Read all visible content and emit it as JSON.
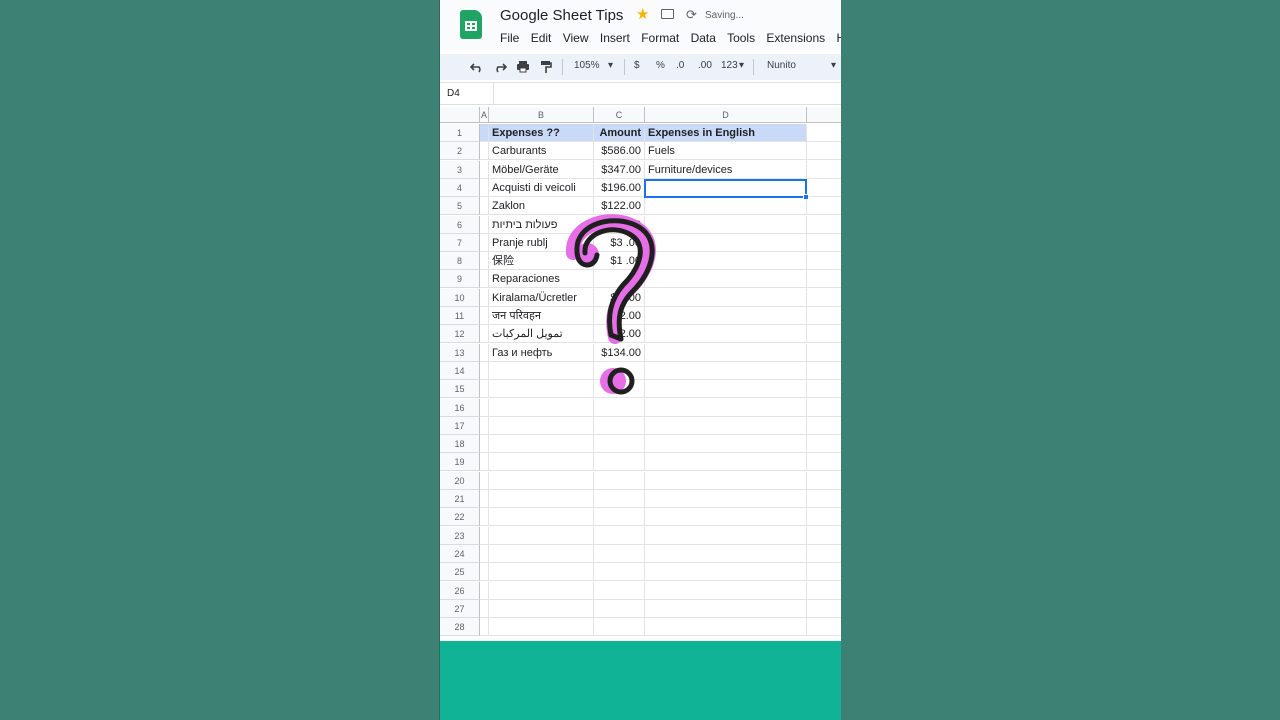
{
  "app": {
    "title": "Google Sheet Tips",
    "status": "Saving...",
    "menu": [
      "File",
      "Edit",
      "View",
      "Insert",
      "Format",
      "Data",
      "Tools",
      "Extensions",
      "H"
    ]
  },
  "toolbar": {
    "zoom": "105%",
    "currency": "$",
    "percent": "%",
    "dec_decrease": ".0",
    "dec_increase": ".00",
    "number_format": "123",
    "font": "Nunito"
  },
  "formula": {
    "name_box": "D4",
    "value": ""
  },
  "columns": [
    "A",
    "B",
    "C",
    "D"
  ],
  "rows": [
    {
      "num": "1",
      "b": "Expenses ??",
      "c": "Amount",
      "d": "Expenses in English"
    },
    {
      "num": "2",
      "b": "Carburants",
      "c": "$586.00",
      "d": "Fuels"
    },
    {
      "num": "3",
      "b": "Möbel/Geräte",
      "c": "$347.00",
      "d": "Furniture/devices"
    },
    {
      "num": "4",
      "b": "Acquisti di veicoli",
      "c": "$196.00",
      "d": ""
    },
    {
      "num": "5",
      "b": "Zaklon",
      "c": "$122.00",
      "d": ""
    },
    {
      "num": "6",
      "b": "פעולות ביתיות",
      "c": "$   .00",
      "d": ""
    },
    {
      "num": "7",
      "b": "Pranje rublj",
      "c": "$3   .00",
      "d": ""
    },
    {
      "num": "8",
      "b": "保险",
      "c": "$1   .00",
      "d": ""
    },
    {
      "num": "9",
      "b": "Reparaciones",
      "c": "   .00",
      "d": ""
    },
    {
      "num": "10",
      "b": "Kiralama/Ücretler",
      "c": "$6   .00",
      "d": ""
    },
    {
      "num": "11",
      "b": "जन परिवहन",
      "c": "$22.00",
      "d": ""
    },
    {
      "num": "12",
      "b": "تمويل المركبات",
      "c": "$22.00",
      "d": ""
    },
    {
      "num": "13",
      "b": "Газ и нефть",
      "c": "$134.00",
      "d": ""
    },
    {
      "num": "14",
      "b": "",
      "c": "",
      "d": ""
    },
    {
      "num": "15",
      "b": "",
      "c": "",
      "d": ""
    },
    {
      "num": "16",
      "b": "",
      "c": "",
      "d": ""
    },
    {
      "num": "17",
      "b": "",
      "c": "",
      "d": ""
    },
    {
      "num": "18",
      "b": "",
      "c": "",
      "d": ""
    },
    {
      "num": "19",
      "b": "",
      "c": "",
      "d": ""
    },
    {
      "num": "20",
      "b": "",
      "c": "",
      "d": ""
    },
    {
      "num": "21",
      "b": "",
      "c": "",
      "d": ""
    },
    {
      "num": "22",
      "b": "",
      "c": "",
      "d": ""
    },
    {
      "num": "23",
      "b": "",
      "c": "",
      "d": ""
    },
    {
      "num": "24",
      "b": "",
      "c": "",
      "d": ""
    },
    {
      "num": "25",
      "b": "",
      "c": "",
      "d": ""
    },
    {
      "num": "26",
      "b": "",
      "c": "",
      "d": ""
    },
    {
      "num": "27",
      "b": "",
      "c": "",
      "d": ""
    },
    {
      "num": "28",
      "b": "",
      "c": "",
      "d": ""
    }
  ],
  "colors": {
    "background": "#3d8074",
    "header_fill": "#c9daf8",
    "selection": "#1a73e8",
    "footer": "#10b396",
    "overlay_pink": "#e66ee6",
    "overlay_ink": "#1f1f1f"
  },
  "overlay": {
    "icon": "question-mark-icon"
  }
}
